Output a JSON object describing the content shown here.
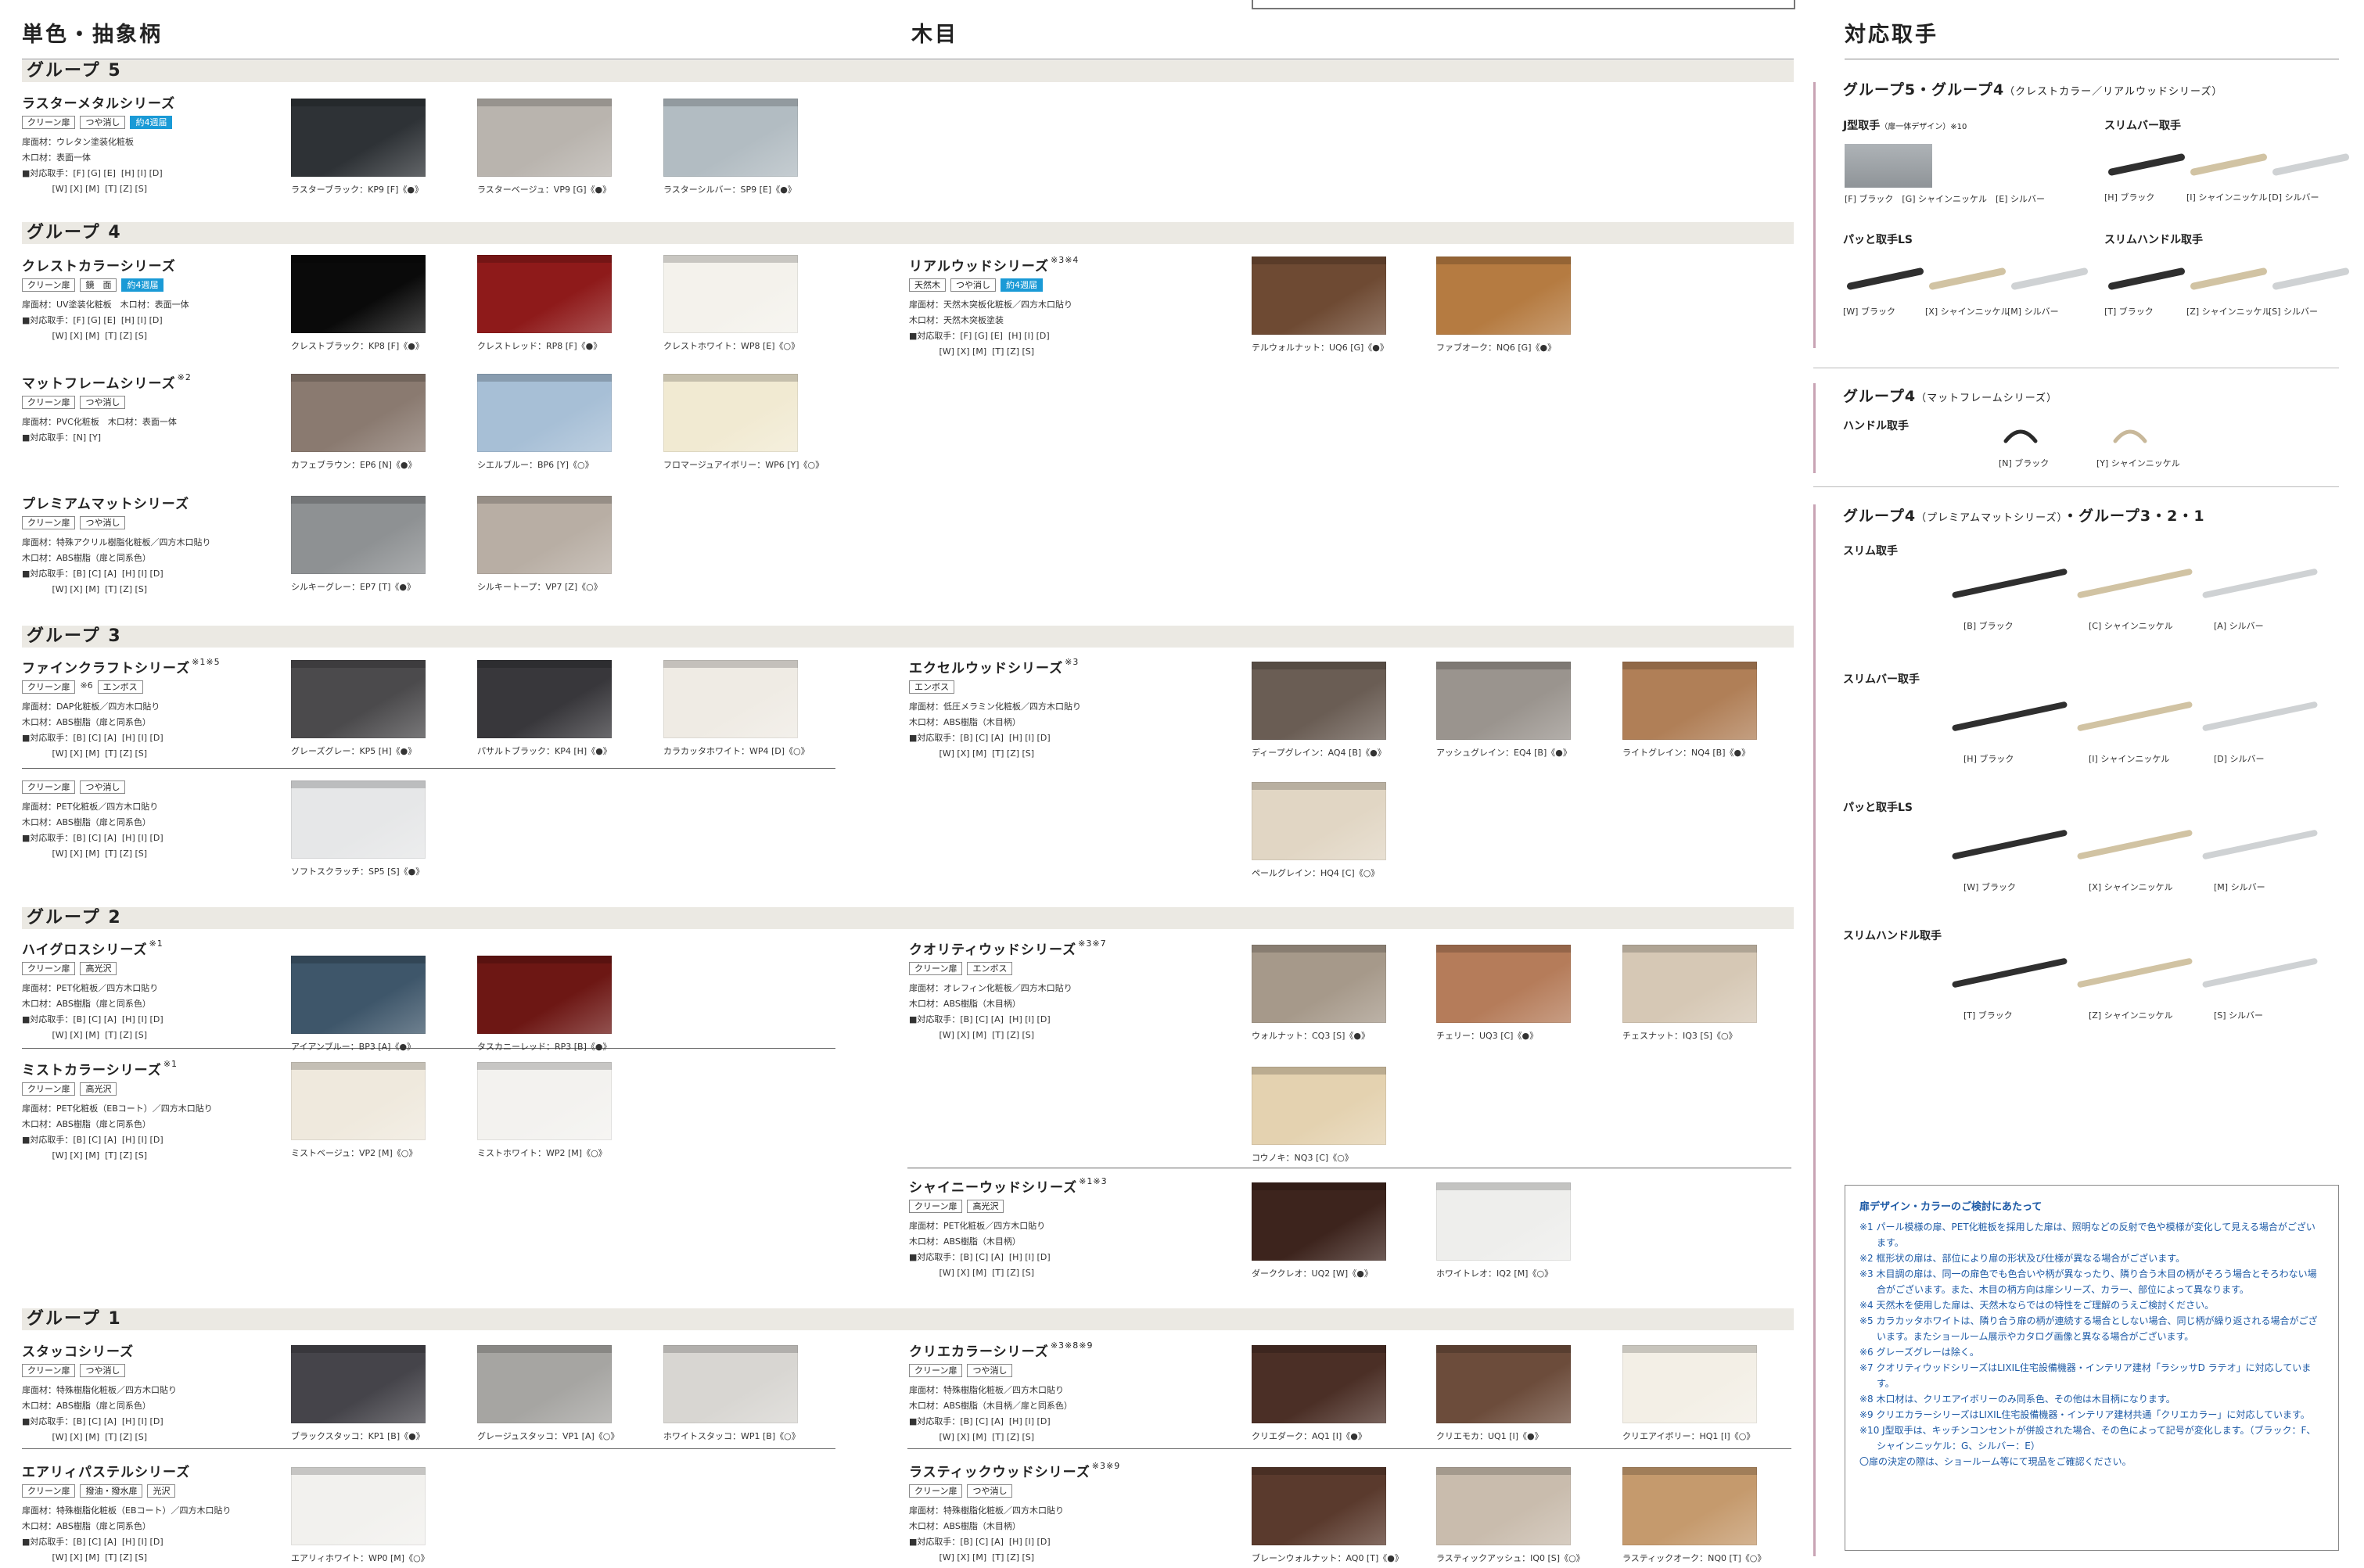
{
  "headers": {
    "solid": "単色・抽象柄",
    "wood": "木目",
    "handles": "対応取手"
  },
  "groups": {
    "g5": "グループ 5",
    "g4": "グループ 4",
    "g3": "グループ 3",
    "g2": "グループ 2",
    "g1": "グループ 1"
  },
  "series": [
    {
      "id": "raster",
      "name": "ラスターメタルシリーズ",
      "sup": "",
      "tags": [
        {
          "t": "クリーン扉"
        },
        {
          "t": "つや消し"
        },
        {
          "t": "約4週届",
          "blue": true
        }
      ],
      "note": "",
      "details": "扉面材：ウレタン塗装化粧板\n木口材：表面一体\n■対応取手：[F] [G] [E]  [H] [I] [D]\n           [W] [X] [M]  [T] [Z] [S]",
      "swatches": [
        {
          "caption": "ラスターブラック：KP9 [F]《●》",
          "color": "#2e3236"
        },
        {
          "caption": "ラスターベージュ：VP9 [G]《●》",
          "color": "#b9b4ae"
        },
        {
          "caption": "ラスターシルバー：SP9 [E]《●》",
          "color": "#b2bcc2"
        }
      ]
    },
    {
      "id": "crest",
      "name": "クレストカラーシリーズ",
      "sup": "",
      "tags": [
        {
          "t": "クリーン扉"
        },
        {
          "t": "鏡　面"
        },
        {
          "t": "約4週届",
          "blue": true
        }
      ],
      "note": "",
      "details": "扉面材：UV塗装化粧板　木口材：表面一体\n■対応取手：[F] [G] [E]  [H] [I] [D]\n           [W] [X] [M]  [T] [Z] [S]",
      "swatches": [
        {
          "caption": "クレストブラック：KP8 [F]《●》",
          "color": "#0a0a0a"
        },
        {
          "caption": "クレストレッド：RP8 [F]《●》",
          "color": "#8e1a1a"
        },
        {
          "caption": "クレストホワイト：WP8 [E]《○》",
          "color": "#f4f2ec"
        }
      ]
    },
    {
      "id": "matframe",
      "name": "マットフレームシリーズ",
      "sup": "※2",
      "tags": [
        {
          "t": "クリーン扉"
        },
        {
          "t": "つや消し"
        }
      ],
      "note": "",
      "details": "扉面材：PVC化粧板　木口材：表面一体\n■対応取手：[N] [Y]",
      "swatches": [
        {
          "caption": "カフェブラウン：EP6 [N]《●》",
          "color": "#8a7a70"
        },
        {
          "caption": "シエルブルー：BP6 [Y]《○》",
          "color": "#a7bfd6"
        },
        {
          "caption": "フロマージュアイボリー：WP6 [Y]《○》",
          "color": "#f1ead2"
        }
      ]
    },
    {
      "id": "premium",
      "name": "プレミアムマットシリーズ",
      "sup": "",
      "tags": [
        {
          "t": "クリーン扉"
        },
        {
          "t": "つや消し"
        }
      ],
      "note": "",
      "details": "扉面材：特殊アクリル樹脂化粧板／四方木口貼り\n木口材：ABS樹脂（扉と同系色）\n■対応取手：[B] [C] [A]  [H] [I] [D]\n           [W] [X] [M]  [T] [Z] [S]",
      "swatches": [
        {
          "caption": "シルキーグレー：EP7 [T]《●》",
          "color": "#8e9193"
        },
        {
          "caption": "シルキートープ：VP7 [Z]《○》",
          "color": "#b8aea4"
        }
      ]
    },
    {
      "id": "fine1",
      "name": "ファインクラフトシリーズ",
      "sup": "※1※5",
      "tags": [
        {
          "t": "クリーン扉"
        },
        {
          "t": "エンボス"
        }
      ],
      "note": "※6",
      "details": "扉面材：DAP化粧板／四方木口貼り\n木口材：ABS樹脂（扉と同系色）\n■対応取手：[B] [C] [A]  [H] [I] [D]\n           [W] [X] [M]  [T] [Z] [S]",
      "swatches": [
        {
          "caption": "グレーズグレー：KP5 [H]《●》",
          "color": "#4b4a4c"
        },
        {
          "caption": "パサルトブラック：KP4 [H]《●》",
          "color": "#38373b"
        },
        {
          "caption": "カラカッタホワイト：WP4 [D]《○》",
          "color": "#efebe4"
        }
      ]
    },
    {
      "id": "fine2",
      "name": "",
      "sup": "",
      "tags": [
        {
          "t": "クリーン扉"
        },
        {
          "t": "つや消し"
        }
      ],
      "note": "",
      "details": "扉面材：PET化粧板／四方木口貼り\n木口材：ABS樹脂（扉と同系色）\n■対応取手：[B] [C] [A]  [H] [I] [D]\n           [W] [X] [M]  [T] [Z] [S]",
      "swatches": [
        {
          "caption": "ソフトスクラッチ：SP5 [S]《●》",
          "color": "#e6e7e8"
        }
      ]
    },
    {
      "id": "higloss",
      "name": "ハイグロスシリーズ",
      "sup": "※1",
      "tags": [
        {
          "t": "クリーン扉"
        },
        {
          "t": "高光沢"
        }
      ],
      "note": "",
      "details": "扉面材：PET化粧板／四方木口貼り\n木口材：ABS樹脂（扉と同系色）\n■対応取手：[B] [C] [A]  [H] [I] [D]\n           [W] [X] [M]  [T] [Z] [S]",
      "swatches": [
        {
          "caption": "アイアンブルー：BP3 [A]《●》",
          "color": "#3e566a"
        },
        {
          "caption": "タスカニーレッド：RP3 [B]《●》",
          "color": "#6d1714"
        }
      ]
    },
    {
      "id": "mist",
      "name": "ミストカラーシリーズ",
      "sup": "※1",
      "tags": [
        {
          "t": "クリーン扉"
        },
        {
          "t": "高光沢"
        }
      ],
      "note": "",
      "details": "扉面材：PET化粧板（EBコート）／四方木口貼り\n木口材：ABS樹脂（扉と同系色）\n■対応取手：[B] [C] [A]  [H] [I] [D]\n           [W] [X] [M]  [T] [Z] [S]",
      "swatches": [
        {
          "caption": "ミストベージュ：VP2 [M]《○》",
          "color": "#efe9dd"
        },
        {
          "caption": "ミストホワイト：WP2 [M]《○》",
          "color": "#f3f2ef"
        }
      ]
    },
    {
      "id": "stucco",
      "name": "スタッコシリーズ",
      "sup": "",
      "tags": [
        {
          "t": "クリーン扉"
        },
        {
          "t": "つや消し"
        }
      ],
      "note": "",
      "details": "扉面材：特殊樹脂化粧板／四方木口貼り\n木口材：ABS樹脂（扉と同系色）\n■対応取手：[B] [C] [A]  [H] [I] [D]\n           [W] [X] [M]  [T] [Z] [S]",
      "swatches": [
        {
          "caption": "ブラックスタッコ：KP1 [B]《●》",
          "color": "#45444a"
        },
        {
          "caption": "グレージュスタッコ：VP1 [A]《○》",
          "color": "#a6a5a2"
        },
        {
          "caption": "ホワイトスタッコ：WP1 [B]《○》",
          "color": "#d8d6d2"
        }
      ]
    },
    {
      "id": "airy",
      "name": "エアリィパステルシリーズ",
      "sup": "",
      "tags": [
        {
          "t": "クリーン扉"
        },
        {
          "t": "撥油・撥水扉"
        },
        {
          "t": "光沢"
        }
      ],
      "note": "",
      "details": "扉面材：特殊樹脂化粧板（EBコート）／四方木口貼り\n木口材：ABS樹脂（扉と同系色）\n■対応取手：[B] [C] [A]  [H] [I] [D]\n           [W] [X] [M]  [T] [Z] [S]",
      "swatches": [
        {
          "caption": "エアリィホワイト：WP0 [M]《○》",
          "color": "#f2f1ee"
        }
      ]
    },
    {
      "id": "real",
      "name": "リアルウッドシリーズ",
      "sup": "※3※4",
      "tags": [
        {
          "t": "天然木"
        },
        {
          "t": "つや消し"
        },
        {
          "t": "約4週届",
          "blue": true
        }
      ],
      "note": "",
      "details": "扉面材：天然木突板化粧板／四方木口貼り\n木口材：天然木突板塗装\n■対応取手：[F] [G] [E]  [H] [I] [D]\n           [W] [X] [M]  [T] [Z] [S]",
      "swatches": [
        {
          "caption": "テルウォルナット：UQ6 [G]《●》",
          "color": "#6e4a33"
        },
        {
          "caption": "ファブオーク：NQ6 [G]《●》",
          "color": "#b57b41"
        }
      ]
    },
    {
      "id": "excel",
      "name": "エクセルウッドシリーズ",
      "sup": "※3",
      "tags": [
        {
          "t": "エンボス"
        }
      ],
      "note": "",
      "details": "扉面材：低圧メラミン化粧板／四方木口貼り\n木口材：ABS樹脂（木目柄）\n■対応取手：[B] [C] [A]  [H] [I] [D]\n           [W] [X] [M]  [T] [Z] [S]",
      "swatches": [
        {
          "caption": "ディープグレイン：AQ4 [B]《●》",
          "color": "#6a5d54"
        },
        {
          "caption": "アッシュグレイン：EQ4 [B]《●》",
          "color": "#9a948e"
        },
        {
          "caption": "ライトグレイン：NQ4 [B]《●》",
          "color": "#b07f57"
        },
        {
          "caption": "ペールグレイン：HQ4 [C]《○》",
          "color": "#e1d6c4"
        }
      ]
    },
    {
      "id": "quality",
      "name": "クオリティウッドシリーズ",
      "sup": "※3※7",
      "tags": [
        {
          "t": "クリーン扉"
        },
        {
          "t": "エンボス"
        }
      ],
      "note": "",
      "details": "扉面材：オレフィン化粧板／四方木口貼り\n木口材：ABS樹脂（木目柄）\n■対応取手：[B] [C] [A]  [H] [I] [D]\n           [W] [X] [M]  [T] [Z] [S]",
      "swatches": [
        {
          "caption": "ウォルナット：CQ3 [S]《●》",
          "color": "#a6998a"
        },
        {
          "caption": "チェリー：UQ3 [C]《●》",
          "color": "#b57c5a"
        },
        {
          "caption": "チェスナット：IQ3 [S]《○》",
          "color": "#d6c8b5"
        },
        {
          "caption": "コウノキ：NQ3 [C]《○》",
          "color": "#e4d2b0"
        }
      ]
    },
    {
      "id": "shiny",
      "name": "シャイニーウッドシリーズ",
      "sup": "※1※3",
      "tags": [
        {
          "t": "クリーン扉"
        },
        {
          "t": "高光沢"
        }
      ],
      "note": "",
      "details": "扉面材：PET化粧板／四方木口貼り\n木口材：ABS樹脂（木目柄）\n■対応取手：[B] [C] [A]  [H] [I] [D]\n           [W] [X] [M]  [T] [Z] [S]",
      "swatches": [
        {
          "caption": "ダーククレオ：UQ2 [W]《●》",
          "color": "#3d241d"
        },
        {
          "caption": "ホワイトレオ：IQ2 [M]《○》",
          "color": "#eeeeec"
        }
      ]
    },
    {
      "id": "crie",
      "name": "クリエカラーシリーズ",
      "sup": "※3※8※9",
      "tags": [
        {
          "t": "クリーン扉"
        },
        {
          "t": "つや消し"
        }
      ],
      "note": "",
      "details": "扉面材：特殊樹脂化粧板／四方木口貼り\n木口材：ABS樹脂（木目柄／扉と同系色）\n■対応取手：[B] [C] [A]  [H] [I] [D]\n           [W] [X] [M]  [T] [Z] [S]",
      "swatches": [
        {
          "caption": "クリエダーク：AQ1 [I]《●》",
          "color": "#4b2f26"
        },
        {
          "caption": "クリエモカ：UQ1 [I]《●》",
          "color": "#6c4c3b"
        },
        {
          "caption": "クリエアイボリー：HQ1 [I]《○》",
          "color": "#f3efe6"
        }
      ]
    },
    {
      "id": "rustic",
      "name": "ラスティックウッドシリーズ",
      "sup": "※3※9",
      "tags": [
        {
          "t": "クリーン扉"
        },
        {
          "t": "つや消し"
        }
      ],
      "note": "",
      "details": "扉面材：特殊樹脂化粧板／四方木口貼り\n木口材：ABS樹脂（木目柄）\n■対応取手：[B] [C] [A]  [H] [I] [D]\n           [W] [X] [M]  [T] [Z] [S]",
      "swatches": [
        {
          "caption": "ブレーンウォルナット：AQ0 [T]《●》",
          "color": "#5a3a2d"
        },
        {
          "caption": "ラスティックアッシュ：IQ0 [S]《○》",
          "color": "#c9bcad"
        },
        {
          "caption": "ラスティックオーク：NQ0 [T]《○》",
          "color": "#c59a6d"
        }
      ]
    }
  ],
  "handles": {
    "s1": {
      "title": "グループ5・グループ4",
      "sub": "（クレストカラー／リアルウッドシリーズ）",
      "j": {
        "name": "J型取手",
        "sub": "（扉一体デザイン）",
        "sup": "※10",
        "caps": "[F] ブラック　[G] シャインニッケル　[E] シルバー"
      },
      "slimbar": {
        "name": "スリムバー取手",
        "caps": [
          "[H] ブラック",
          "[I] シャインニッケル",
          "[D] シルバー"
        ]
      },
      "pattols": {
        "name": "パッと取手LS",
        "caps": [
          "[W] ブラック",
          "[X] シャインニッケル",
          "[M] シルバー"
        ]
      },
      "slimhandle": {
        "name": "スリムハンドル取手",
        "caps": [
          "[T] ブラック",
          "[Z] シャインニッケル",
          "[S] シルバー"
        ]
      }
    },
    "s2": {
      "title": "グループ4",
      "sub": "（マットフレームシリーズ）",
      "handle": {
        "name": "ハンドル取手",
        "caps": [
          "[N] ブラック",
          "[Y] シャインニッケル"
        ]
      }
    },
    "s3": {
      "title": "グループ4",
      "sub": "（プレミアムマットシリーズ）",
      "title2": "・グループ3・2・1",
      "slim": {
        "name": "スリム取手",
        "caps": [
          "[B] ブラック",
          "[C] シャインニッケル",
          "[A] シルバー"
        ]
      },
      "slimbar": {
        "name": "スリムバー取手",
        "caps": [
          "[H] ブラック",
          "[I] シャインニッケル",
          "[D] シルバー"
        ]
      },
      "pattols": {
        "name": "パッと取手LS",
        "caps": [
          "[W] ブラック",
          "[X] シャインニッケル",
          "[M] シルバー"
        ]
      },
      "slimhandle": {
        "name": "スリムハンドル取手",
        "caps": [
          "[T] ブラック",
          "[Z] シャインニッケル",
          "[S] シルバー"
        ]
      }
    }
  },
  "notes": {
    "title": "扉デザイン・カラーのご検討にあたって",
    "items": [
      "※1 パール模様の扉、PET化粧板を採用した扉は、照明などの反射で色や模様が変化して見える場合がございます。",
      "※2 框形状の扉は、部位により扉の形状及び仕様が異なる場合がございます。",
      "※3 木目調の扉は、同一の扉色でも色合いや柄が異なったり、隣り合う木目の柄がそろう場合とそろわない場合がございます。また、木目の柄方向は扉シリーズ、カラー、部位によって異なります。",
      "※4 天然木を使用した扉は、天然木ならではの特性をご理解のうえご検討ください。",
      "※5 カラカッタホワイトは、隣り合う扉の柄が連続する場合としない場合、同じ柄が繰り返される場合がございます。またショールーム展示やカタログ画像と異なる場合がございます。",
      "※6 グレーズグレーは除く。",
      "※7 クオリティウッドシリーズはLIXIL住宅設備機器・インテリア建材「ラシッサD ラテオ」に対応しています。",
      "※8 木口材は、クリエアイボリーのみ同系色、その他は木目柄になります。",
      "※9 クリエカラーシリーズはLIXIL住宅設備機器・インテリア建材共通「クリエカラー」に対応しています。",
      "※10 J型取手は、キッチンコンセントが併設された場合、その色によって記号が変化します。（ブラック：F、シャインニッケル：G、シルバー：E）",
      "〇扉の決定の際は、ショールーム等にて現品をご確認ください。"
    ]
  }
}
